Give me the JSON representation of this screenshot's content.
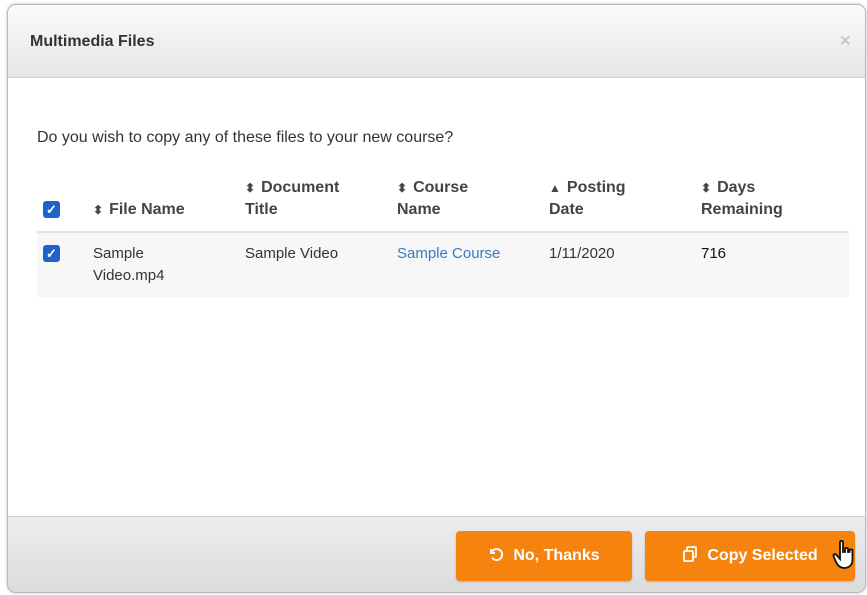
{
  "dialog": {
    "title": "Multimedia Files",
    "close_glyph": "×",
    "prompt": "Do you wish to copy any of these files to your new course?"
  },
  "table": {
    "headers": {
      "file_name": "File Name",
      "document_title_1": "Document",
      "document_title_2": "Title",
      "course_name_1": "Course",
      "course_name_2": "Name",
      "posting_date_1": "Posting",
      "posting_date_2": "Date",
      "days_remaining_1": "Days",
      "days_remaining_2": "Remaining"
    },
    "sort_glyphs": {
      "both": "⬍",
      "up": "▲"
    },
    "rows": [
      {
        "checked": true,
        "file_name_1": "Sample",
        "file_name_2": "Video.mp4",
        "document_title": "Sample Video",
        "course_name": "Sample Course",
        "posting_date": "1/11/2020",
        "days_remaining": "716"
      }
    ]
  },
  "footer": {
    "no_thanks_label": "No, Thanks",
    "no_thanks_icon": "undo-icon",
    "copy_selected_label": "Copy Selected",
    "copy_selected_icon": "copy-icon"
  },
  "colors": {
    "accent_orange": "#f7830f",
    "checkbox_blue": "#1f63c9",
    "link_blue": "#3b78c5"
  }
}
